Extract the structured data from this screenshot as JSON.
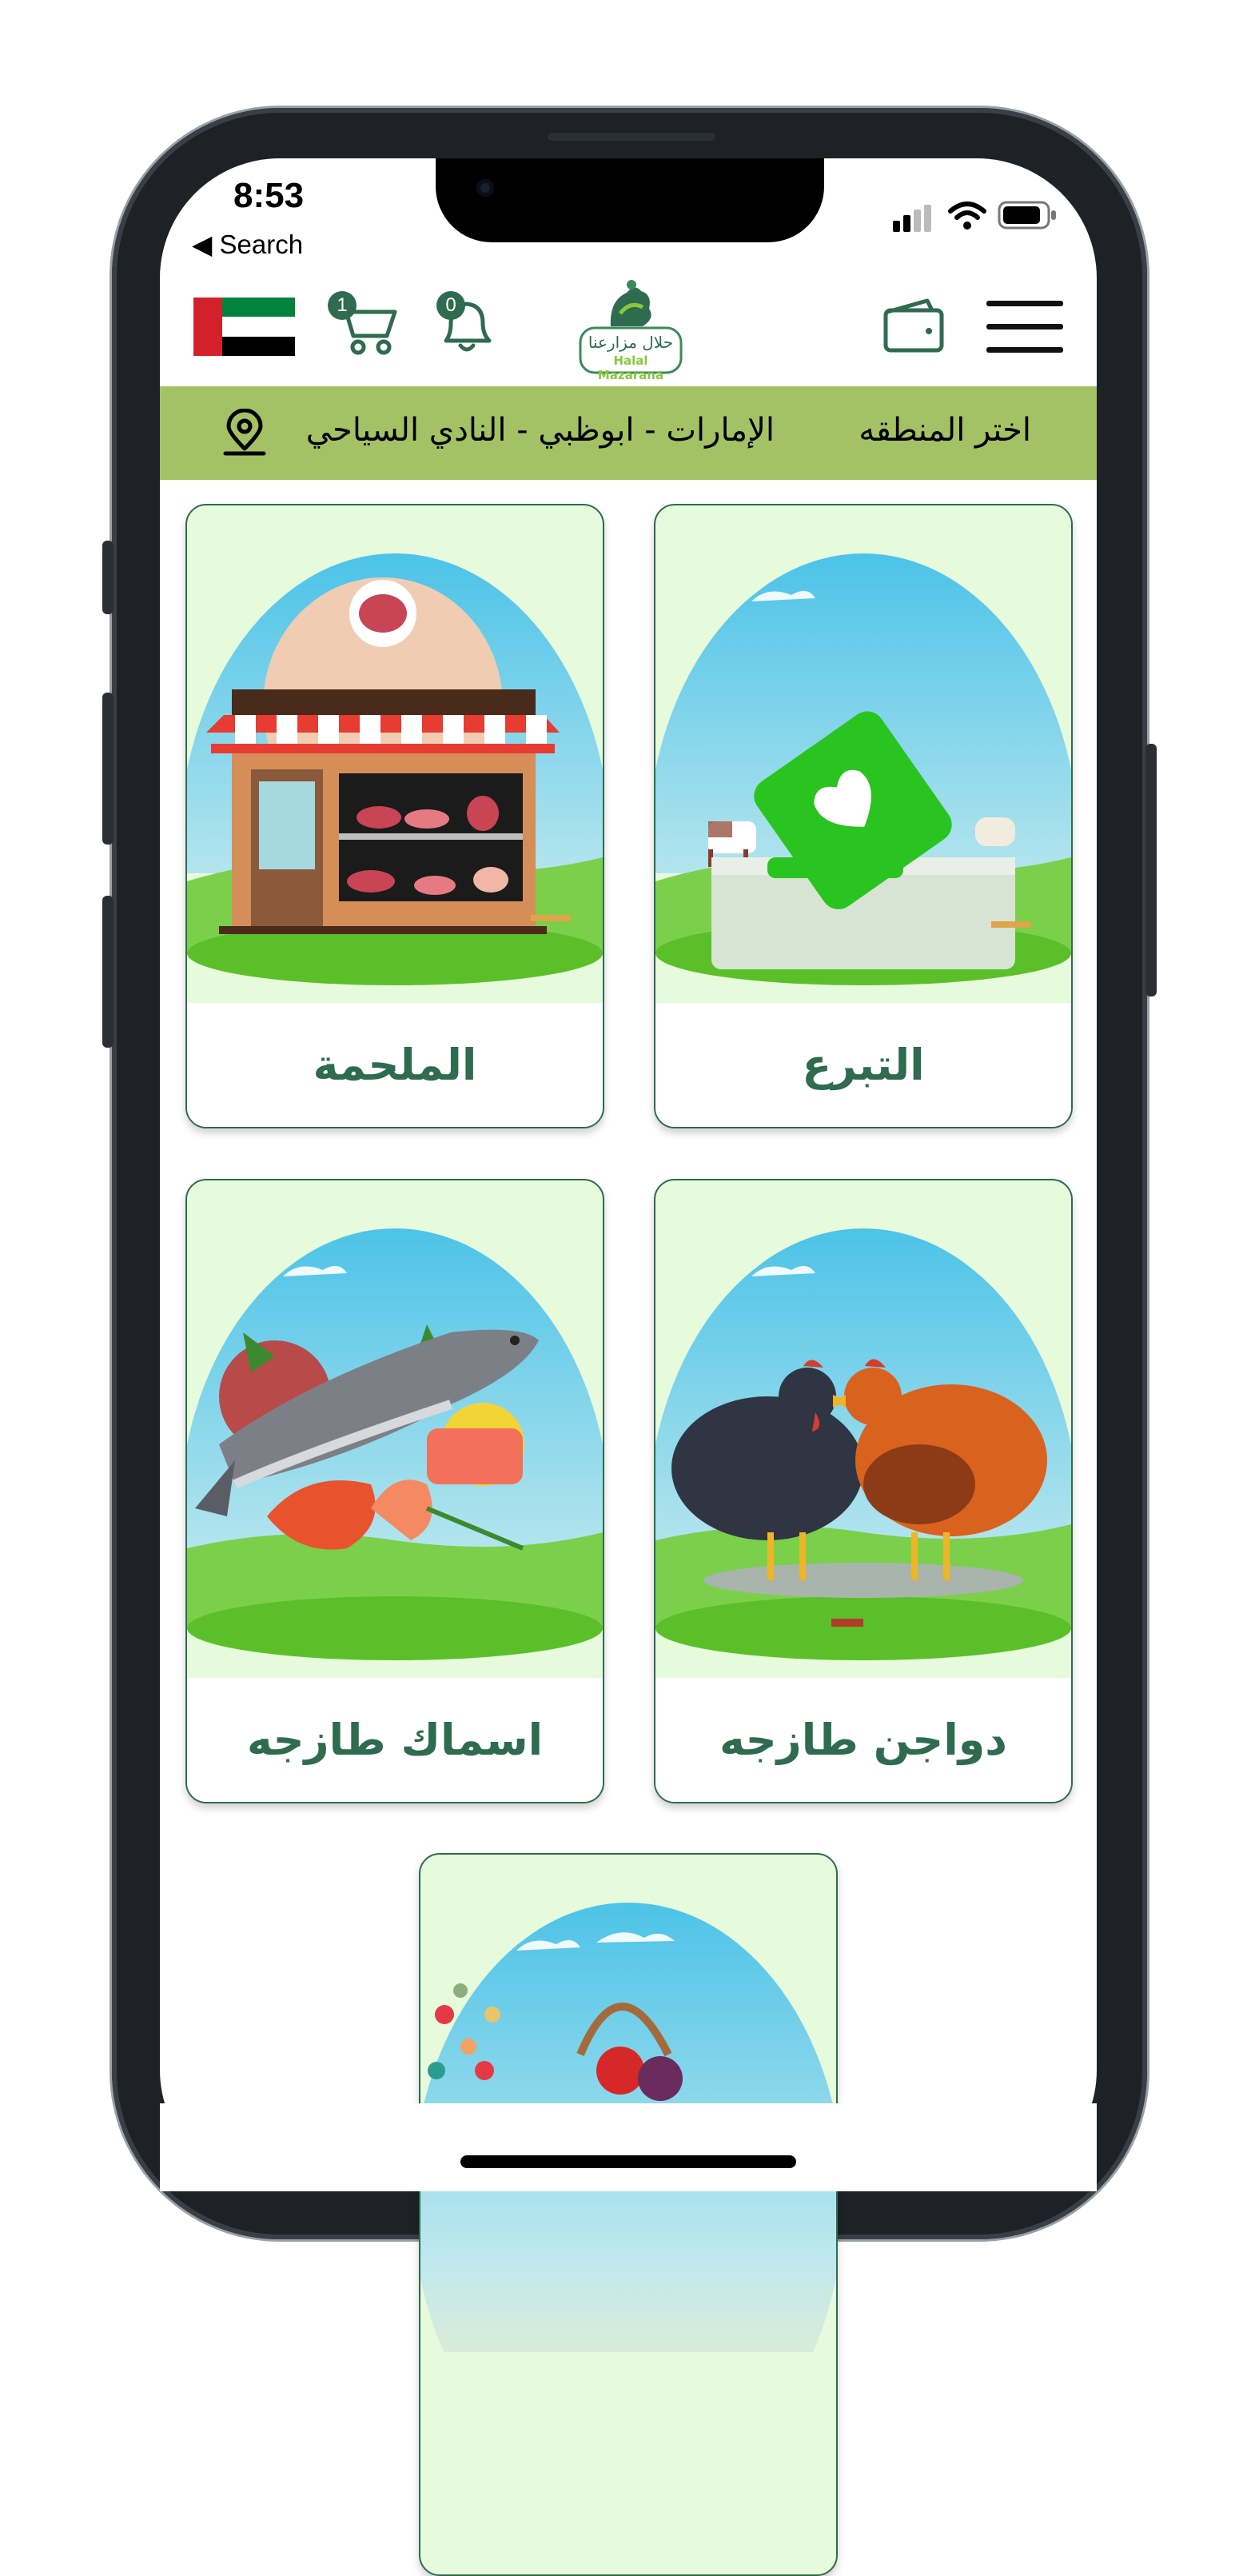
{
  "status_bar": {
    "time": "8:53",
    "back_label": "◀ Search"
  },
  "header": {
    "cart_count": "1",
    "notification_count": "0",
    "logo_text_ar": "حلال مزارعنا",
    "logo_text_en": "Halal Mazarana"
  },
  "region": {
    "label": "اختر المنطقه",
    "value": "الإمارات - ابوظبي - النادي السياحي"
  },
  "categories": [
    {
      "label": "التبرع"
    },
    {
      "label": "الملحمة"
    },
    {
      "label": "دواجن طازجه"
    },
    {
      "label": "اسماك طازجه"
    },
    {
      "label": ""
    }
  ],
  "colors": {
    "accent_green": "#2e6b4f",
    "region_bar": "#a3c265",
    "card_bg": "#e6fbdc"
  },
  "icons": [
    "uae-flag-icon",
    "cart-icon",
    "bell-icon",
    "wallet-icon",
    "menu-icon",
    "location-pin-icon",
    "signal-icon",
    "wifi-icon",
    "battery-icon"
  ]
}
